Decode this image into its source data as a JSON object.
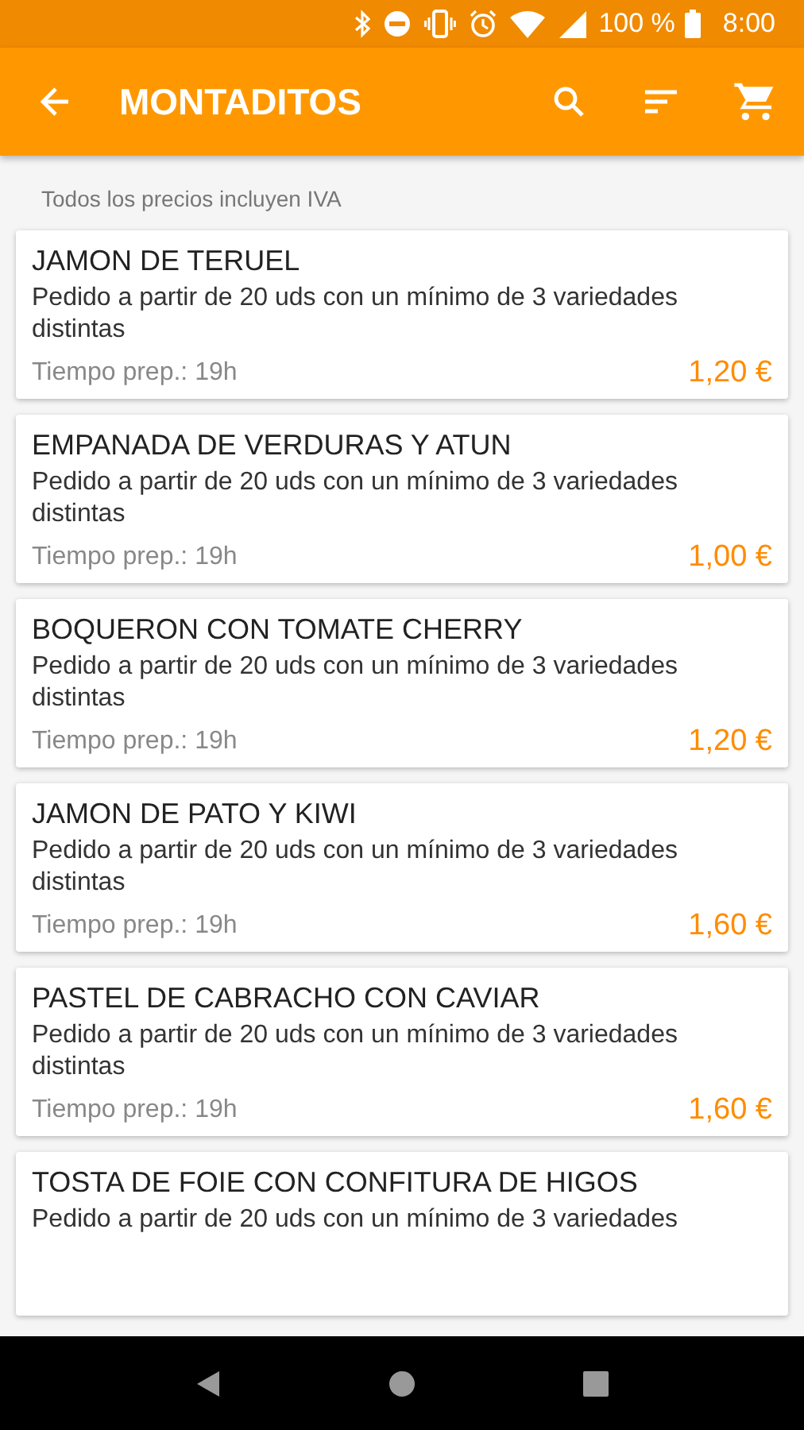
{
  "status_bar": {
    "battery_text": "100 %",
    "time": "8:00"
  },
  "app_bar": {
    "title": "MONTADITOS"
  },
  "note": "Todos los precios incluyen IVA",
  "products": [
    {
      "name": "JAMON DE TERUEL",
      "description": "Pedido a partir de 20 uds con un mínimo de 3 variedades distintas",
      "prep_time": "Tiempo prep.: 19h",
      "price": "1,20 €"
    },
    {
      "name": "EMPANADA DE VERDURAS Y ATUN",
      "description": "Pedido a partir de 20 uds con un mínimo de 3 variedades distintas",
      "prep_time": "Tiempo prep.: 19h",
      "price": "1,00 €"
    },
    {
      "name": "BOQUERON CON TOMATE CHERRY",
      "description": "Pedido a partir de 20 uds con un mínimo de 3 variedades distintas",
      "prep_time": "Tiempo prep.: 19h",
      "price": "1,20 €"
    },
    {
      "name": "JAMON DE PATO Y KIWI",
      "description": "Pedido a partir de 20 uds con un mínimo de 3 variedades distintas",
      "prep_time": "Tiempo prep.: 19h",
      "price": "1,60 €"
    },
    {
      "name": "PASTEL DE CABRACHO CON CAVIAR",
      "description": "Pedido a partir de 20 uds con un mínimo de 3 variedades distintas",
      "prep_time": "Tiempo prep.: 19h",
      "price": "1,60 €"
    },
    {
      "name": "TOSTA DE FOIE CON CONFITURA DE HIGOS",
      "description": "Pedido a partir de 20 uds con un mínimo de 3 variedades"
    }
  ]
}
